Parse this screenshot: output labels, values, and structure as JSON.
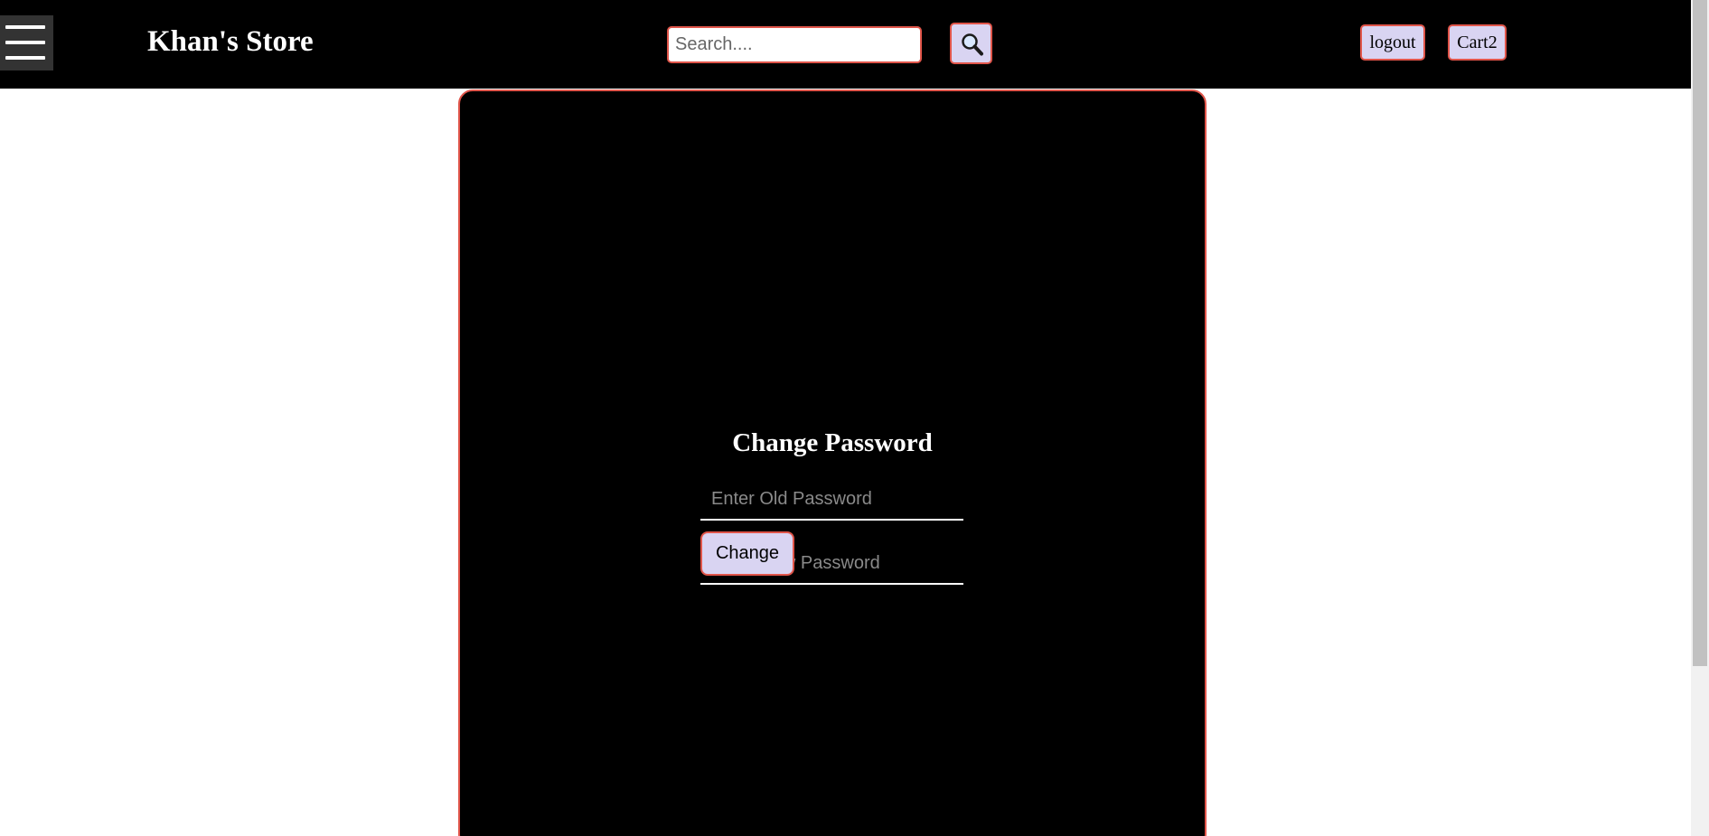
{
  "header": {
    "brand": "Khan's Store",
    "search_placeholder": "Search....",
    "search_button_icon": "search-icon",
    "logout_label": "logout",
    "cart_label": "Cart2",
    "menu_icon": "hamburger-menu-icon"
  },
  "form": {
    "title": "Change Password",
    "old_password_placeholder": "Enter Old Password",
    "new_password_placeholder": "Enter New Password",
    "submit_label": "Change"
  },
  "colors": {
    "header_bg": "#000000",
    "panel_bg": "#000000",
    "accent_border": "#e0554a",
    "button_bg": "#d9d4f2",
    "page_bg": "#ffffff"
  }
}
